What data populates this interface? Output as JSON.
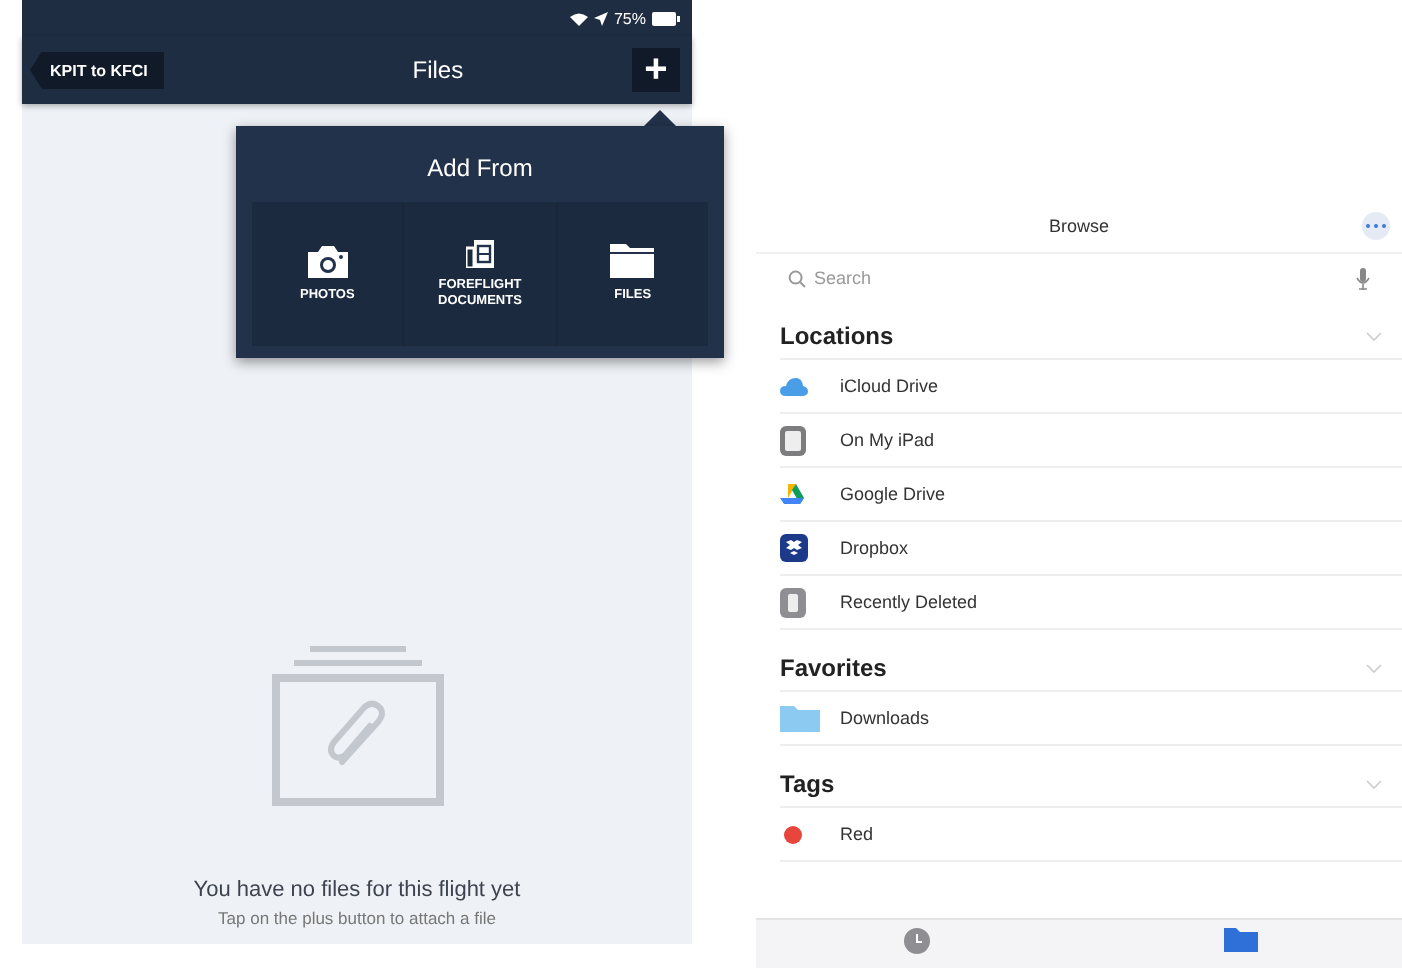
{
  "left": {
    "status_bar": {
      "battery": "75%"
    },
    "nav": {
      "back": "KPIT to KFCI",
      "title": "Files",
      "add": "+"
    },
    "popover": {
      "title": "Add From",
      "options": [
        {
          "kind": "camera",
          "label": "PHOTOS"
        },
        {
          "kind": "document",
          "label": "FOREFLIGHT DOCUMENTS"
        },
        {
          "kind": "folder",
          "label": "FILES"
        }
      ]
    },
    "empty": {
      "title": "You have no files for this flight yet",
      "hint": "Tap on the plus button to attach a file"
    }
  },
  "right": {
    "title": "Browse",
    "search": {
      "placeholder": "Search"
    },
    "sections": [
      {
        "title": "Locations",
        "items": [
          {
            "kind": "icloud",
            "label": "iCloud Drive"
          },
          {
            "kind": "ipad",
            "label": "On My iPad"
          },
          {
            "kind": "gdrive",
            "label": "Google Drive"
          },
          {
            "kind": "dropbox",
            "label": "Dropbox"
          },
          {
            "kind": "trash",
            "label": "Recently Deleted"
          }
        ]
      },
      {
        "title": "Favorites",
        "items": [
          {
            "kind": "folder",
            "label": "Downloads"
          }
        ]
      },
      {
        "title": "Tags",
        "items": [
          {
            "kind": "tag",
            "label": "Red",
            "color": "#e8453c"
          }
        ]
      }
    ],
    "tabs": [
      {
        "kind": "clock",
        "selected": false
      },
      {
        "kind": "folder",
        "selected": true
      }
    ]
  }
}
